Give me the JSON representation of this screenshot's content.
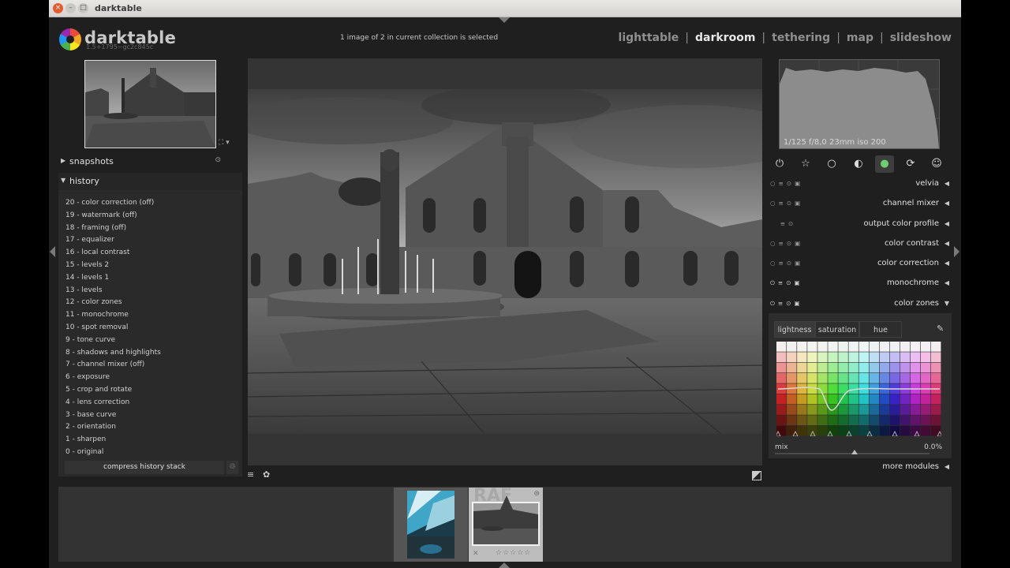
{
  "window": {
    "title": "darktable"
  },
  "logo": {
    "name": "darktable",
    "version": "1.5+1795~gc2c845c"
  },
  "collection_status": "1 image of 2 in current collection is selected",
  "views": [
    "lighttable",
    "darkroom",
    "tethering",
    "map",
    "slideshow"
  ],
  "active_view": "darkroom",
  "left_panel": {
    "snapshots_label": "snapshots",
    "history_label": "history",
    "history_items": [
      "20 - color correction (off)",
      "19 - watermark (off)",
      "18 - framing (off)",
      "17 - equalizer",
      "16 - local contrast",
      "15 - levels 2",
      "14 - levels 1",
      "13 - levels",
      "12 - color zones",
      "11 - monochrome",
      "10 - spot removal",
      "9 - tone curve",
      "8 - shadows and highlights",
      "7 - channel mixer (off)",
      "6 - exposure",
      "5 - crop and rotate",
      "4 - lens correction",
      "3 - base curve",
      "2 - orientation",
      "1 - sharpen",
      "0 - original"
    ],
    "compress_label": "compress history stack"
  },
  "histogram": {
    "info": "1/125 f/8,0 23mm iso 200"
  },
  "module_groups": [
    "power-icon",
    "star-icon",
    "circle-icon",
    "half-circle-icon",
    "color-icon",
    "correct-icon",
    "effect-icon"
  ],
  "modules": [
    {
      "name": "velvia",
      "expanded": false
    },
    {
      "name": "channel mixer",
      "expanded": false
    },
    {
      "name": "output color profile",
      "expanded": false
    },
    {
      "name": "color contrast",
      "expanded": false
    },
    {
      "name": "color correction",
      "expanded": false
    },
    {
      "name": "monochrome",
      "expanded": false
    },
    {
      "name": "color zones",
      "expanded": true
    }
  ],
  "color_zones": {
    "tabs": [
      "lightness",
      "saturation",
      "hue"
    ],
    "active_tab": "lightness",
    "mix_label": "mix",
    "mix_value": "0.0%"
  },
  "more_modules": "more modules",
  "filmstrip": {
    "watermark_text": "RAF"
  },
  "colors": {
    "background": "#1f1f1f",
    "panel": "#2a2a2a",
    "text": "#e0e0e0",
    "accent": "#e6e6e6"
  }
}
